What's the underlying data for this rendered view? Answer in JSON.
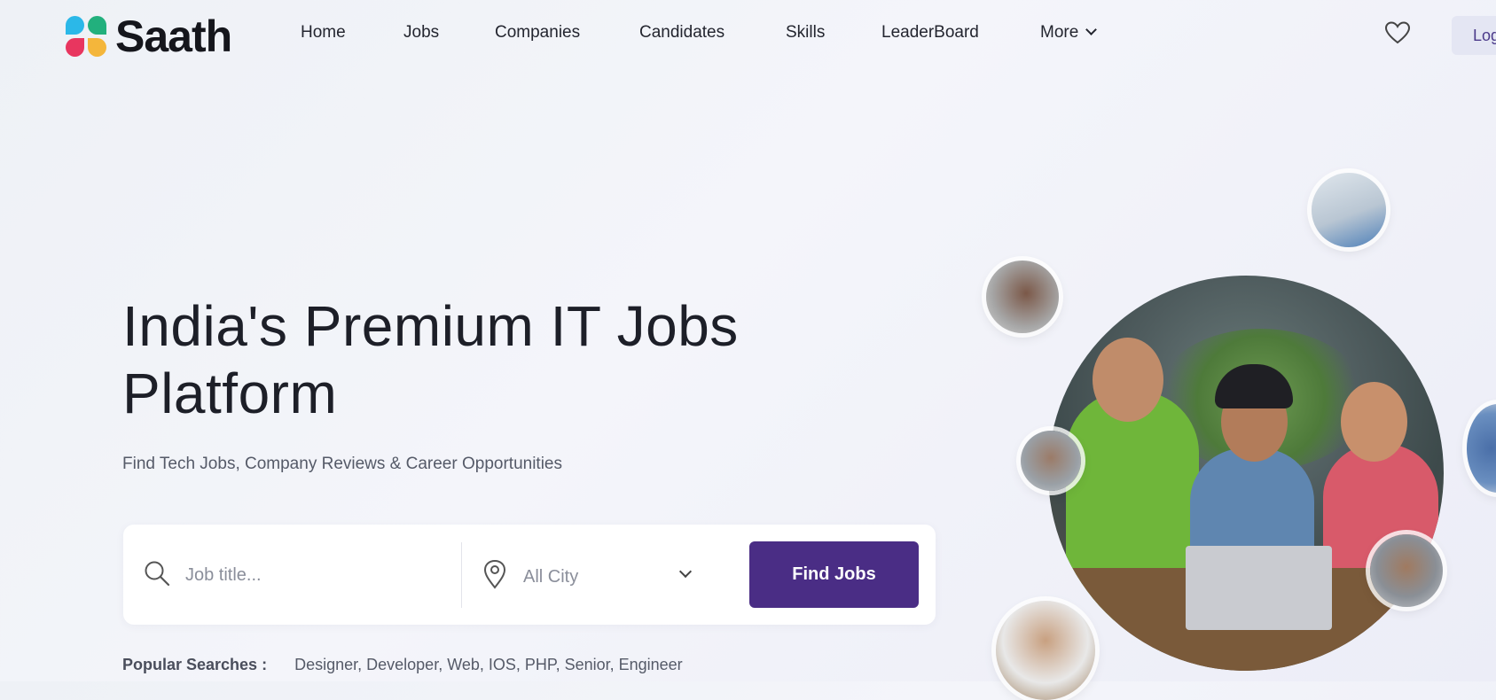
{
  "brand": {
    "name": "Saath"
  },
  "nav": {
    "items": [
      {
        "label": "Home"
      },
      {
        "label": "Jobs"
      },
      {
        "label": "Companies"
      },
      {
        "label": "Candidates"
      },
      {
        "label": "Skills"
      },
      {
        "label": "LeaderBoard"
      },
      {
        "label": "More"
      }
    ],
    "login_label": "Log"
  },
  "hero": {
    "title": "India's Premium IT Jobs Platform",
    "subtitle": "Find Tech Jobs, Company Reviews & Career Opportunities"
  },
  "search": {
    "job_placeholder": "Job title...",
    "city_selected": "All City",
    "button_label": "Find Jobs"
  },
  "popular": {
    "label": "Popular Searches :",
    "tags": "Designer, Developer, Web, IOS, PHP, Senior, Engineer"
  },
  "icons": {
    "search": "search-icon",
    "location": "map-pin-icon",
    "wishlist": "heart-icon",
    "dropdown": "chevron-down-icon"
  },
  "colors": {
    "primary": "#4a2d85",
    "logo_blue": "#2bb8e8",
    "logo_green": "#22b07d",
    "logo_red": "#e8365f",
    "logo_yellow": "#f4b63b"
  }
}
